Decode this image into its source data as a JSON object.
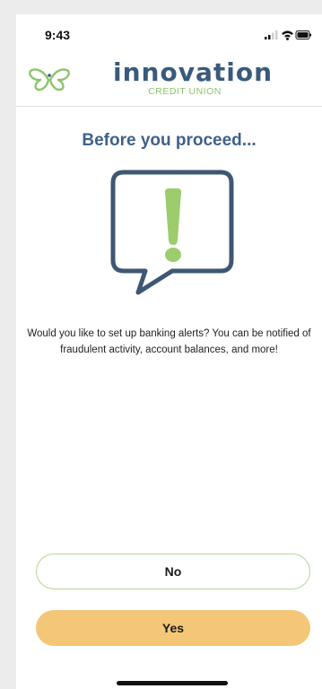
{
  "status_bar": {
    "time": "9:43"
  },
  "header": {
    "brand_name": "innovation",
    "brand_sub": "CREDIT UNION"
  },
  "main": {
    "title": "Before you proceed...",
    "message": "Would you like to set up banking alerts? You can be notified of fraudulent activity, account balances, and more!"
  },
  "buttons": {
    "no_label": "No",
    "yes_label": "Yes"
  },
  "colors": {
    "brand_blue": "#3a5a7c",
    "title_blue": "#3f6189",
    "brand_green": "#8cc46a",
    "yes_button": "#f4c778",
    "no_button_border": "#b4d59a"
  },
  "icons": {
    "logo": "butterfly-logo-icon",
    "alert": "speech-bubble-exclamation-icon",
    "signal": "cellular-signal-icon",
    "wifi": "wifi-icon",
    "battery": "battery-icon"
  }
}
